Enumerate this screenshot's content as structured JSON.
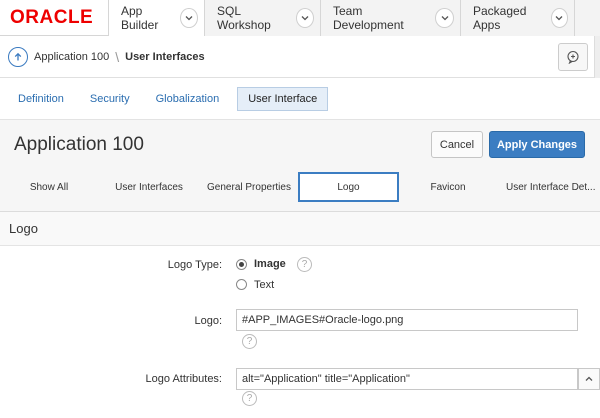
{
  "brand": {
    "logo_text": "ORACLE",
    "color": "#e00000"
  },
  "topnav": {
    "tabs": [
      {
        "label": "App Builder",
        "active": true
      },
      {
        "label": "SQL Workshop"
      },
      {
        "label": "Team Development"
      },
      {
        "label": "Packaged Apps"
      }
    ]
  },
  "breadcrumb": {
    "parent": "Application 100",
    "separator": "\\",
    "current": "User Interfaces"
  },
  "subtabs": {
    "items": [
      {
        "label": "Definition"
      },
      {
        "label": "Security"
      },
      {
        "label": "Globalization"
      },
      {
        "label": "User Interface",
        "active": true
      }
    ]
  },
  "page": {
    "title": "Application 100",
    "cancel_label": "Cancel",
    "apply_label": "Apply Changes",
    "accent": "#3b7dc2"
  },
  "form_tabs": [
    {
      "label": "Show All"
    },
    {
      "label": "User Interfaces"
    },
    {
      "label": "General Properties"
    },
    {
      "label": "Logo",
      "active": true
    },
    {
      "label": "Favicon"
    },
    {
      "label": "User Interface Det..."
    }
  ],
  "logo_section": {
    "heading": "Logo",
    "logo_type_label": "Logo Type:",
    "options": {
      "image": "Image",
      "text": "Text"
    },
    "selected": "Image",
    "logo_label": "Logo:",
    "logo_value": "#APP_IMAGES#Oracle-logo.png",
    "attributes_label": "Logo Attributes:",
    "attributes_value": "alt=\"Application\" title=\"Application\"",
    "help_glyph": "?"
  }
}
